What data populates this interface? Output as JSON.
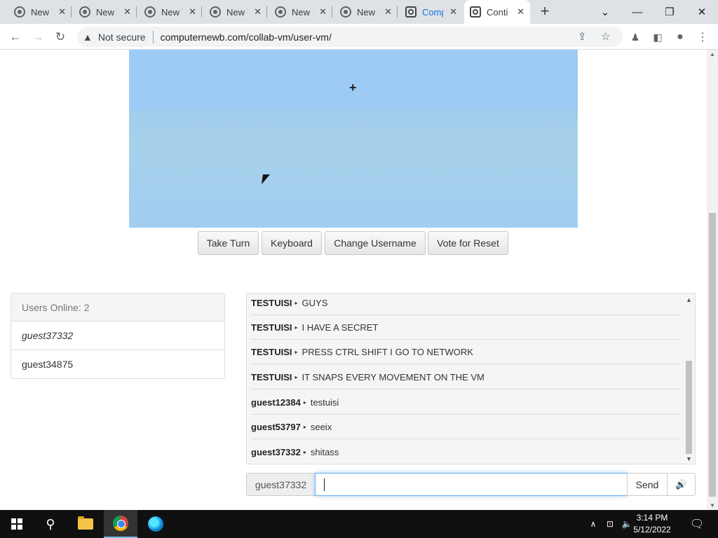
{
  "browser": {
    "tabs": [
      {
        "title": "New Tab",
        "icon": "chrome-icon"
      },
      {
        "title": "New Tab",
        "icon": "chrome-icon"
      },
      {
        "title": "New Tab",
        "icon": "chrome-icon"
      },
      {
        "title": "New Tab",
        "icon": "chrome-icon"
      },
      {
        "title": "New Tab",
        "icon": "chrome-icon"
      },
      {
        "title": "New Tab",
        "icon": "chrome-icon"
      },
      {
        "title": "Comp",
        "icon": "collabvm-icon"
      },
      {
        "title": "Conti",
        "icon": "collabvm-icon",
        "active": true
      }
    ],
    "new_tab_symbol": "+",
    "window_controls": {
      "chevron": "⌄",
      "minimize": "—",
      "restore": "❐",
      "close": "✕"
    },
    "nav": {
      "back": "←",
      "forward": "→",
      "reload": "↻"
    },
    "security_label": "Not secure",
    "url": "computernewb.com/collab-vm/user-vm/",
    "omnibox_icons": [
      "share-icon",
      "bookmark-star-icon"
    ],
    "toolbar_icons": [
      "extensions-icon",
      "side-panel-icon",
      "profile-icon",
      "menu-icon"
    ]
  },
  "vm": {
    "screen_colors": {
      "top": "#9ecbf6",
      "bottom": "#a2cdf1"
    },
    "crosshair": "+",
    "buttons": {
      "take_turn": "Take Turn",
      "keyboard": "Keyboard",
      "change_username": "Change Username",
      "vote_reset": "Vote for Reset"
    }
  },
  "users": {
    "header": "Users Online: 2",
    "list": [
      "guest37332",
      "guest34875"
    ],
    "current_user": "guest37332"
  },
  "chat": {
    "messages": [
      {
        "user": "TESTUISI",
        "text": "GUYS"
      },
      {
        "user": "TESTUISI",
        "text": "I HAVE A SECRET"
      },
      {
        "user": "TESTUISI",
        "text": "PRESS CTRL SHIFT I GO TO NETWORK"
      },
      {
        "user": "TESTUISI",
        "text": "IT SNAPS EVERY MOVEMENT ON THE VM"
      },
      {
        "user": "guest12384",
        "text": "testuisi"
      },
      {
        "user": "guest53797",
        "text": "seeix"
      },
      {
        "user": "guest37332",
        "text": "shitass"
      }
    ],
    "name_label": "guest37332",
    "input_value": "",
    "send_label": "Send",
    "sound_icon": "speaker-icon"
  },
  "taskbar": {
    "apps": [
      "start-icon",
      "search-icon",
      "file-explorer-icon",
      "chrome-icon",
      "edge-icon"
    ],
    "time": "3:14 PM",
    "date": "5/12/2022",
    "tray_symbols": {
      "chevron": "∧",
      "network": "⊡",
      "volume": "🔈",
      "notifications": "🗨"
    }
  }
}
